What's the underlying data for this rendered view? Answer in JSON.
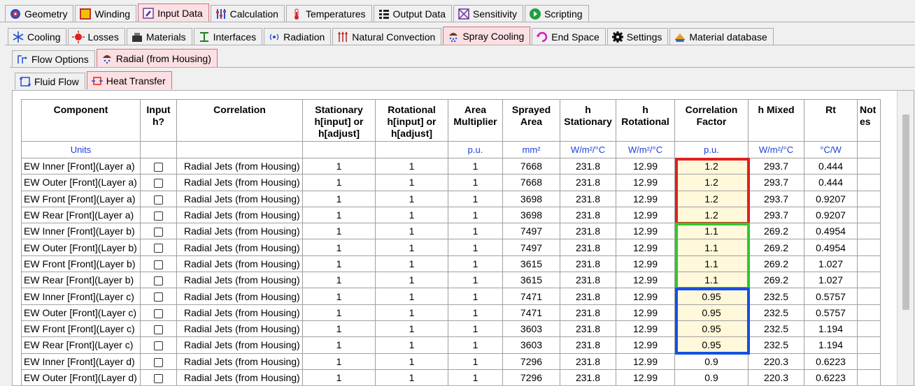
{
  "tabs_level1": [
    {
      "label": "Geometry",
      "icon": "geometry-icon"
    },
    {
      "label": "Winding",
      "icon": "winding-icon"
    },
    {
      "label": "Input Data",
      "icon": "input-data-icon",
      "active": true
    },
    {
      "label": "Calculation",
      "icon": "calculation-icon"
    },
    {
      "label": "Temperatures",
      "icon": "thermometer-icon"
    },
    {
      "label": "Output Data",
      "icon": "output-data-icon"
    },
    {
      "label": "Sensitivity",
      "icon": "sensitivity-icon"
    },
    {
      "label": "Scripting",
      "icon": "scripting-icon"
    }
  ],
  "tabs_level2": [
    {
      "label": "Cooling",
      "icon": "snowflake-icon"
    },
    {
      "label": "Losses",
      "icon": "losses-icon"
    },
    {
      "label": "Materials",
      "icon": "materials-icon"
    },
    {
      "label": "Interfaces",
      "icon": "interfaces-icon"
    },
    {
      "label": "Radiation",
      "icon": "radiation-icon"
    },
    {
      "label": "Natural Convection",
      "icon": "natural-convection-icon"
    },
    {
      "label": "Spray Cooling",
      "icon": "spray-cooling-icon",
      "active": true
    },
    {
      "label": "End Space",
      "icon": "end-space-icon"
    },
    {
      "label": "Settings",
      "icon": "settings-gear-icon"
    },
    {
      "label": "Material database",
      "icon": "material-database-icon"
    }
  ],
  "tabs_level3": [
    {
      "label": "Flow Options",
      "icon": "flow-options-icon"
    },
    {
      "label": "Radial (from Housing)",
      "icon": "radial-housing-icon",
      "active": true
    }
  ],
  "tabs_level4": [
    {
      "label": "Fluid Flow",
      "icon": "fluid-flow-icon"
    },
    {
      "label": "Heat Transfer",
      "icon": "heat-transfer-icon",
      "active": true
    }
  ],
  "table": {
    "headers": [
      "Component",
      "Input h?",
      "Correlation",
      "Stationary h[input] or h[adjust]",
      "Rotational h[input] or h[adjust]",
      "Area Multiplier",
      "Sprayed Area",
      "h Stationary",
      "h Rotational",
      "Correlation Factor",
      "h Mixed",
      "Rt",
      "Notes"
    ],
    "units": [
      "Units",
      "",
      "",
      "",
      "",
      "p.u.",
      "mm²",
      "W/m²/°C",
      "W/m²/°C",
      "p.u.",
      "W/m²/°C",
      "°C/W",
      ""
    ],
    "rows": [
      [
        "EW Inner [Front](Layer a)",
        "Radial Jets (from Housing)",
        "1",
        "1",
        "1",
        "7668",
        "231.8",
        "12.99",
        "1.2",
        "293.7",
        "0.444"
      ],
      [
        "EW Outer [Front](Layer a)",
        "Radial Jets (from Housing)",
        "1",
        "1",
        "1",
        "7668",
        "231.8",
        "12.99",
        "1.2",
        "293.7",
        "0.444"
      ],
      [
        "EW Front [Front](Layer a)",
        "Radial Jets (from Housing)",
        "1",
        "1",
        "1",
        "3698",
        "231.8",
        "12.99",
        "1.2",
        "293.7",
        "0.9207"
      ],
      [
        "EW Rear [Front](Layer a)",
        "Radial Jets (from Housing)",
        "1",
        "1",
        "1",
        "3698",
        "231.8",
        "12.99",
        "1.2",
        "293.7",
        "0.9207"
      ],
      [
        "EW Inner [Front](Layer b)",
        "Radial Jets (from Housing)",
        "1",
        "1",
        "1",
        "7497",
        "231.8",
        "12.99",
        "1.1",
        "269.2",
        "0.4954"
      ],
      [
        "EW Outer [Front](Layer b)",
        "Radial Jets (from Housing)",
        "1",
        "1",
        "1",
        "7497",
        "231.8",
        "12.99",
        "1.1",
        "269.2",
        "0.4954"
      ],
      [
        "EW Front [Front](Layer b)",
        "Radial Jets (from Housing)",
        "1",
        "1",
        "1",
        "3615",
        "231.8",
        "12.99",
        "1.1",
        "269.2",
        "1.027"
      ],
      [
        "EW Rear [Front](Layer b)",
        "Radial Jets (from Housing)",
        "1",
        "1",
        "1",
        "3615",
        "231.8",
        "12.99",
        "1.1",
        "269.2",
        "1.027"
      ],
      [
        "EW Inner [Front](Layer c)",
        "Radial Jets (from Housing)",
        "1",
        "1",
        "1",
        "7471",
        "231.8",
        "12.99",
        "0.95",
        "232.5",
        "0.5757"
      ],
      [
        "EW Outer [Front](Layer c)",
        "Radial Jets (from Housing)",
        "1",
        "1",
        "1",
        "7471",
        "231.8",
        "12.99",
        "0.95",
        "232.5",
        "0.5757"
      ],
      [
        "EW Front [Front](Layer c)",
        "Radial Jets (from Housing)",
        "1",
        "1",
        "1",
        "3603",
        "231.8",
        "12.99",
        "0.95",
        "232.5",
        "1.194"
      ],
      [
        "EW Rear [Front](Layer c)",
        "Radial Jets (from Housing)",
        "1",
        "1",
        "1",
        "3603",
        "231.8",
        "12.99",
        "0.95",
        "232.5",
        "1.194"
      ],
      [
        "EW Inner [Front](Layer d)",
        "Radial Jets (from Housing)",
        "1",
        "1",
        "1",
        "7296",
        "231.8",
        "12.99",
        "0.9",
        "220.3",
        "0.6223"
      ],
      [
        "EW Outer [Front](Layer d)",
        "Radial Jets (from Housing)",
        "1",
        "1",
        "1",
        "7296",
        "231.8",
        "12.99",
        "0.9",
        "220.3",
        "0.6223"
      ]
    ]
  },
  "highlight_colors": {
    "layer_a": "#e02020",
    "layer_b": "#2ec82e",
    "layer_c": "#1450e0"
  },
  "colors": {
    "active_tab": "#fcdfe3",
    "units_text": "#1f3ed8",
    "correlation_cell": "#fff8da"
  }
}
